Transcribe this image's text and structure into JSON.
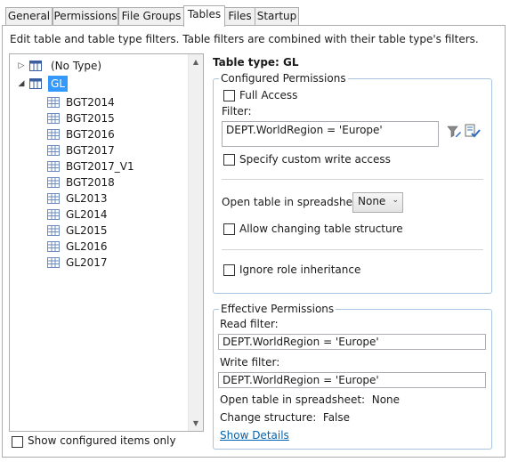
{
  "tabs": [
    "General",
    "Permissions",
    "File Groups",
    "Tables",
    "Files",
    "Startup"
  ],
  "active_tab": "Tables",
  "description": "Edit table and table type filters. Table filters are combined with their table type's filters.",
  "tree": {
    "nodes": [
      {
        "label": "(No Type)",
        "expander": "▷",
        "selected": false
      },
      {
        "label": "GL",
        "expander": "◢",
        "selected": true
      }
    ],
    "children": [
      "BGT2014",
      "BGT2015",
      "BGT2016",
      "BGT2017",
      "BGT2017_V1",
      "BGT2018",
      "GL2013",
      "GL2014",
      "GL2015",
      "GL2016",
      "GL2017"
    ]
  },
  "show_configured_only": {
    "label": "Show configured items only",
    "checked": false
  },
  "details": {
    "heading": "Table type: GL",
    "configured": {
      "legend": "Configured Permissions",
      "full_access_label": "Full Access",
      "filter_label": "Filter:",
      "filter_value": "DEPT.WorldRegion = 'Europe'",
      "custom_write_label": "Specify custom write access",
      "open_table_label": "Open table in spreadsheet:",
      "open_table_value": "None",
      "allow_changing_label": "Allow changing table structure",
      "ignore_role_label": "Ignore role inheritance"
    },
    "effective": {
      "legend": "Effective Permissions",
      "read_filter_label": "Read filter:",
      "read_filter_value": "DEPT.WorldRegion = 'Europe'",
      "write_filter_label": "Write filter:",
      "write_filter_value": "DEPT.WorldRegion = 'Europe'",
      "open_table_text": "Open table in spreadsheet:  None",
      "change_structure_text": "Change structure:  False",
      "show_details_label": "Show Details"
    }
  }
}
